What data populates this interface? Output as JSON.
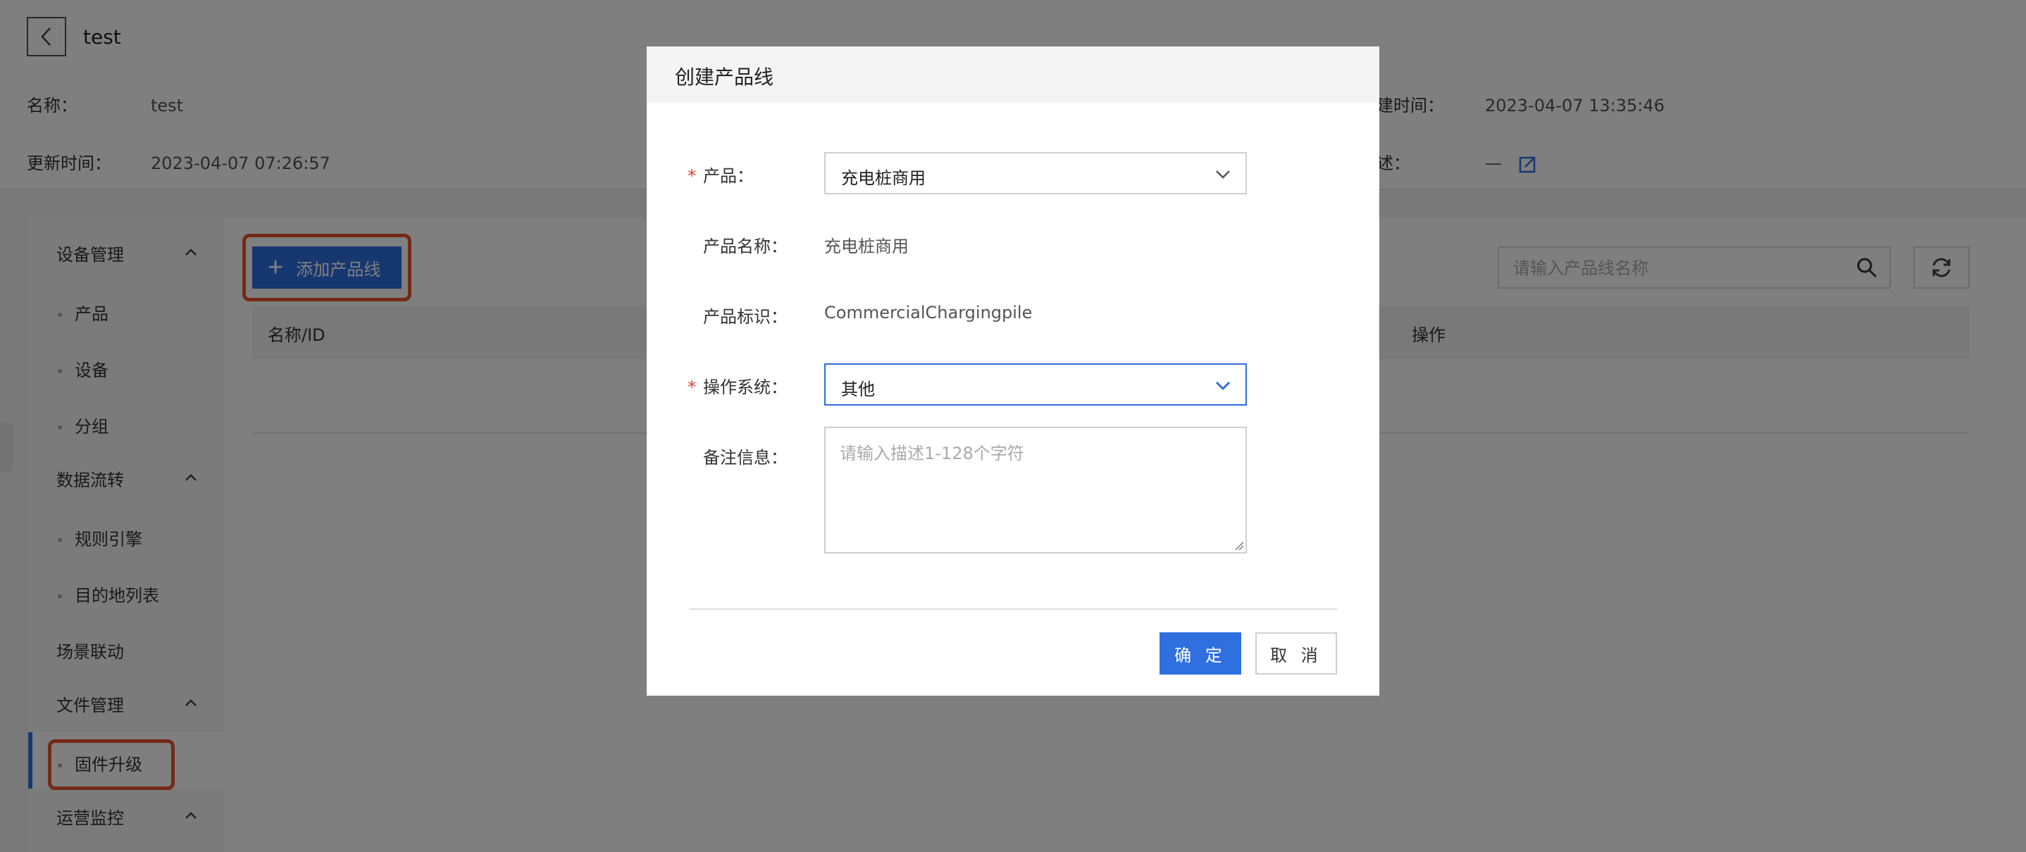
{
  "header": {
    "title": "test",
    "name_label": "名称：",
    "name_value": "test",
    "created_label": "建时间：",
    "created_value": "2023-04-07 13:35:46",
    "updated_label": "更新时间：",
    "updated_value": "2023-04-07 07:26:57",
    "desc_label": "述：",
    "desc_value": "—"
  },
  "sidebar": {
    "groups": [
      {
        "label": "设备管理",
        "items": [
          "产品",
          "设备",
          "分组"
        ]
      },
      {
        "label": "数据流转",
        "items": [
          "规则引擎",
          "目的地列表"
        ]
      },
      {
        "label": "场景联动",
        "items": []
      },
      {
        "label": "文件管理",
        "items": [
          "固件升级"
        ]
      },
      {
        "label": "运营监控",
        "items": []
      }
    ],
    "active_item": "固件升级"
  },
  "main": {
    "add_button_label": "添加产品线",
    "search_placeholder": "请输入产品线名称",
    "table_headers": [
      "名称/ID",
      "操作"
    ]
  },
  "modal": {
    "title": "创建产品线",
    "product_label": "产品：",
    "product_value": "充电桩商用",
    "product_name_label": "产品名称：",
    "product_name_value": "充电桩商用",
    "product_key_label": "产品标识：",
    "product_key_value": "CommercialChargingpile",
    "os_label": "操作系统：",
    "os_value": "其他",
    "remark_label": "备注信息：",
    "remark_placeholder": "请输入描述1-128个字符",
    "confirm_label": "确 定",
    "cancel_label": "取 消"
  },
  "colors": {
    "primary": "#2f6fe0",
    "highlight": "#e8552f",
    "required": "#e23b2e"
  }
}
